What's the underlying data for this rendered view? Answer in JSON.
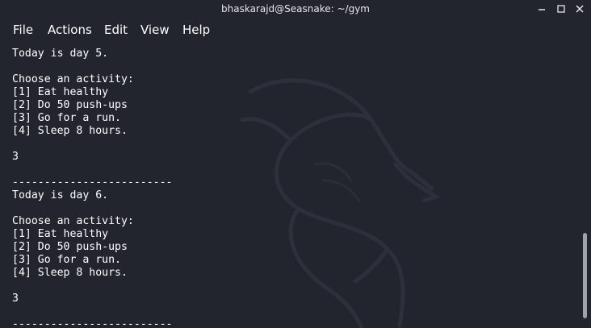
{
  "window": {
    "title": "bhaskarajd@Seasnake: ~/gym",
    "controls": [
      "minimize-icon",
      "maximize-icon",
      "close-icon"
    ]
  },
  "menu": {
    "items": [
      {
        "label": "File"
      },
      {
        "label": "Actions"
      },
      {
        "label": "Edit"
      },
      {
        "label": "View"
      },
      {
        "label": "Help"
      }
    ]
  },
  "terminal": {
    "background_watermark": "kali-dragon-logo",
    "lines": [
      "Today is day 5.",
      "",
      "Choose an activity:",
      "[1] Eat healthy",
      "[2] Do 50 push-ups",
      "[3] Go for a run.",
      "[4] Sleep 8 hours.",
      "",
      "3",
      "",
      "-------------------------",
      "Today is day 6.",
      "",
      "Choose an activity:",
      "[1] Eat healthy",
      "[2] Do 50 push-ups",
      "[3] Go for a run.",
      "[4] Sleep 8 hours.",
      "",
      "3",
      "",
      "-------------------------"
    ],
    "scroll_position": 0.95,
    "visible_fraction": 0.3
  },
  "colors": {
    "background": "#23252e",
    "text": "#ffffff",
    "scrollbar_thumb": "#9da2ab"
  }
}
